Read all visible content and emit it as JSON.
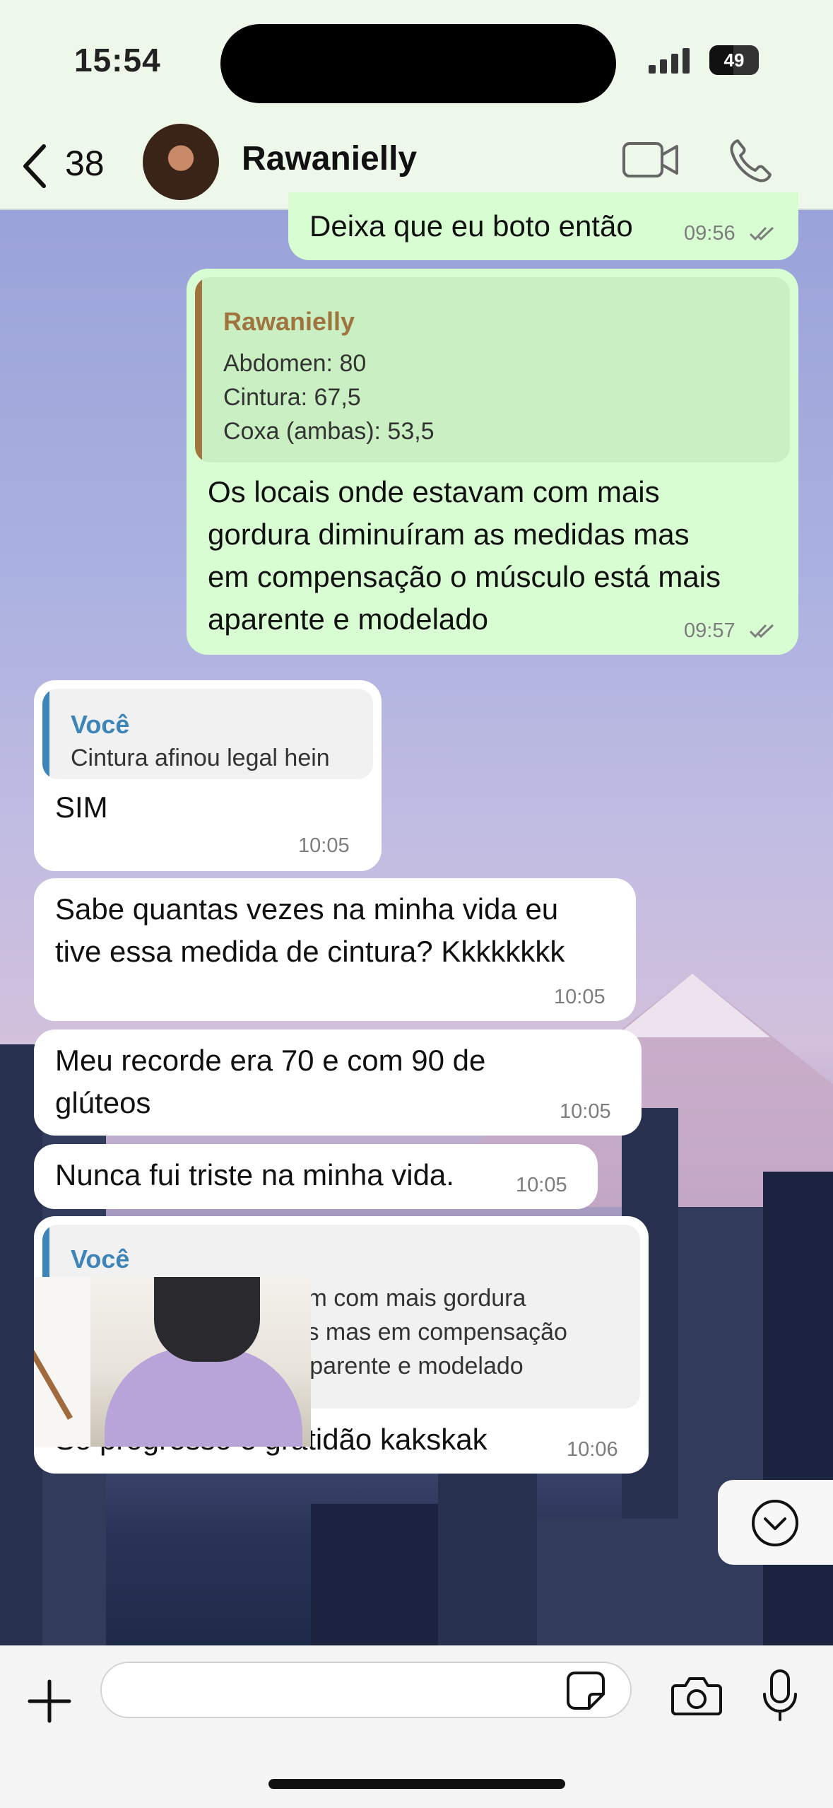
{
  "status_bar": {
    "time": "15:54",
    "battery": "49"
  },
  "header": {
    "back_count": "38",
    "contact_name": "Rawanielly"
  },
  "messages": [
    {
      "direction": "out",
      "text": "Deixa que eu boto então",
      "time": "09:56"
    },
    {
      "direction": "out",
      "quote": {
        "author": "Rawanielly",
        "text": "Abdomen: 80\nCintura: 67,5\nCoxa (ambas): 53,5"
      },
      "text": "Os locais onde estavam com mais\ngordura diminuíram as medidas mas\nem compensação o músculo está mais\naparente e modelado",
      "time": "09:57"
    },
    {
      "direction": "in",
      "quote": {
        "author": "Você",
        "text": "Cintura afinou legal hein"
      },
      "text": "SIM",
      "time": "10:05"
    },
    {
      "direction": "in",
      "text": "Sabe quantas vezes na minha vida eu\ntive essa medida de cintura? Kkkkkkkk",
      "time": "10:05"
    },
    {
      "direction": "in",
      "text": "Meu recorde era 70 e com 90 de\nglúteos",
      "time": "10:05"
    },
    {
      "direction": "in",
      "text": "Nunca fui triste na minha vida.",
      "time": "10:05"
    },
    {
      "direction": "in",
      "quote": {
        "author": "Você",
        "text": "Os locais onde estavam com mais gordura\ndiminuíram as medidas mas em compensação\no músculo está mais aparente e modelado"
      },
      "text": "Só progresso e gratidão kakskak",
      "time": "10:06"
    }
  ],
  "colors": {
    "outgoing_bubble": "#d9fdd3",
    "incoming_bubble": "#ffffff",
    "quote_author_out": "#a0743f",
    "quote_author_in": "#3d84b8"
  },
  "icons": {
    "back": "chevron-left-icon",
    "video": "video-camera-icon",
    "call": "phone-icon",
    "scroll_down": "chevron-down-circle-icon",
    "attach": "plus-icon",
    "sticker": "sticker-icon",
    "camera": "camera-icon",
    "mic": "microphone-icon"
  }
}
